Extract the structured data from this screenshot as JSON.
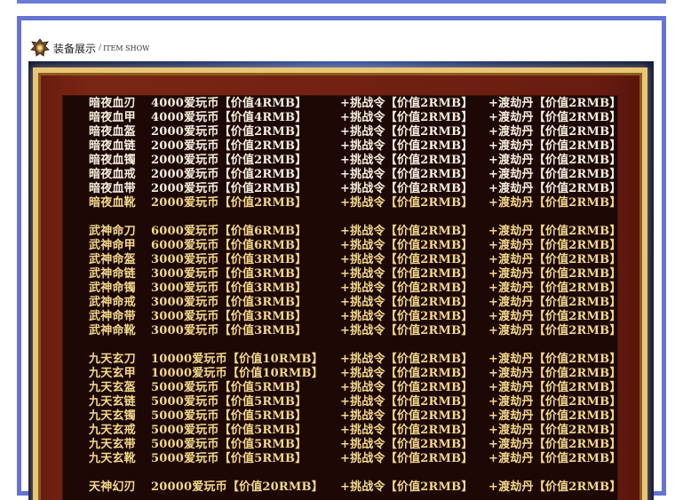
{
  "panel": {
    "title_cn": "装备展示",
    "separator": "/",
    "title_en": "ITEM SHOW"
  },
  "sets": [
    {
      "rows": [
        {
          "name": "暗夜血刃",
          "price": "4000爱玩币【价值4RMB】",
          "challenge": "+挑战令【价值2RMB】",
          "pill": "+渡劫丹【价值2RMB】"
        },
        {
          "name": "暗夜血甲",
          "price": "4000爱玩币【价值4RMB】",
          "challenge": "+挑战令【价值2RMB】",
          "pill": "+渡劫丹【价值2RMB】"
        },
        {
          "name": "暗夜血盔",
          "price": "2000爱玩币【价值2RMB】",
          "challenge": "+挑战令【价值2RMB】",
          "pill": "+渡劫丹【价值2RMB】"
        },
        {
          "name": "暗夜血链",
          "price": "2000爱玩币【价值2RMB】",
          "challenge": "+挑战令【价值2RMB】",
          "pill": "+渡劫丹【价值2RMB】"
        },
        {
          "name": "暗夜血镯",
          "price": "2000爱玩币【价值2RMB】",
          "challenge": "+挑战令【价值2RMB】",
          "pill": "+渡劫丹【价值2RMB】"
        },
        {
          "name": "暗夜血戒",
          "price": "2000爱玩币【价值2RMB】",
          "challenge": "+挑战令【价值2RMB】",
          "pill": "+渡劫丹【价值2RMB】"
        },
        {
          "name": "暗夜血带",
          "price": "2000爱玩币【价值2RMB】",
          "challenge": "+挑战令【价值2RMB】",
          "pill": "+渡劫丹【价值2RMB】"
        },
        {
          "name": "暗夜血靴",
          "price": "2000爱玩币【价值2RMB】",
          "challenge": "+挑战令【价值2RMB】",
          "pill": "+渡劫丹【价值2RMB】"
        }
      ]
    },
    {
      "rows": [
        {
          "name": "武神命刀",
          "price": "6000爱玩币【价值6RMB】",
          "challenge": "+挑战令【价值2RMB】",
          "pill": "+渡劫丹【价值2RMB】"
        },
        {
          "name": "武神命甲",
          "price": "6000爱玩币【价值6RMB】",
          "challenge": "+挑战令【价值2RMB】",
          "pill": "+渡劫丹【价值2RMB】"
        },
        {
          "name": "武神命盔",
          "price": "3000爱玩币【价值3RMB】",
          "challenge": "+挑战令【价值2RMB】",
          "pill": "+渡劫丹【价值2RMB】"
        },
        {
          "name": "武神命链",
          "price": "3000爱玩币【价值3RMB】",
          "challenge": "+挑战令【价值2RMB】",
          "pill": "+渡劫丹【价值2RMB】"
        },
        {
          "name": "武神命镯",
          "price": "3000爱玩币【价值3RMB】",
          "challenge": "+挑战令【价值2RMB】",
          "pill": "+渡劫丹【价值2RMB】"
        },
        {
          "name": "武神命戒",
          "price": "3000爱玩币【价值3RMB】",
          "challenge": "+挑战令【价值2RMB】",
          "pill": "+渡劫丹【价值2RMB】"
        },
        {
          "name": "武神命带",
          "price": "3000爱玩币【价值3RMB】",
          "challenge": "+挑战令【价值2RMB】",
          "pill": "+渡劫丹【价值2RMB】"
        },
        {
          "name": "武神命靴",
          "price": "3000爱玩币【价值3RMB】",
          "challenge": "+挑战令【价值2RMB】",
          "pill": "+渡劫丹【价值2RMB】"
        }
      ]
    },
    {
      "rows": [
        {
          "name": "九天玄刀",
          "price": "10000爱玩币【价值10RMB】",
          "challenge": "+挑战令【价值2RMB】",
          "pill": "+渡劫丹【价值2RMB】"
        },
        {
          "name": "九天玄甲",
          "price": "10000爱玩币【价值10RMB】",
          "challenge": "+挑战令【价值2RMB】",
          "pill": "+渡劫丹【价值2RMB】"
        },
        {
          "name": "九天玄盔",
          "price": "5000爱玩币【价值5RMB】",
          "challenge": "+挑战令【价值2RMB】",
          "pill": "+渡劫丹【价值2RMB】"
        },
        {
          "name": "九天玄链",
          "price": "5000爱玩币【价值5RMB】",
          "challenge": "+挑战令【价值2RMB】",
          "pill": "+渡劫丹【价值2RMB】"
        },
        {
          "name": "九天玄镯",
          "price": "5000爱玩币【价值5RMB】",
          "challenge": "+挑战令【价值2RMB】",
          "pill": "+渡劫丹【价值2RMB】"
        },
        {
          "name": "九天玄戒",
          "price": "5000爱玩币【价值5RMB】",
          "challenge": "+挑战令【价值2RMB】",
          "pill": "+渡劫丹【价值2RMB】"
        },
        {
          "name": "九天玄带",
          "price": "5000爱玩币【价值5RMB】",
          "challenge": "+挑战令【价值2RMB】",
          "pill": "+渡劫丹【价值2RMB】"
        },
        {
          "name": "九天玄靴",
          "price": "5000爱玩币【价值5RMB】",
          "challenge": "+挑战令【价值2RMB】",
          "pill": "+渡劫丹【价值2RMB】"
        }
      ]
    },
    {
      "rows": [
        {
          "name": "天神幻刃",
          "price": "20000爱玩币【价值20RMB】",
          "challenge": "+挑战令【价值2RMB】",
          "pill": "+渡劫丹【价值2RMB】"
        }
      ]
    }
  ],
  "colors": {
    "panel_border": "#6673d4",
    "text_white": "#f6f0de",
    "text_gold": "#f3d98a",
    "frame_gold": "#e9c676",
    "frame_red": "#6a1c10",
    "inner_bg": "#1e0806"
  },
  "icons": {
    "header_icon": "crest-icon"
  }
}
